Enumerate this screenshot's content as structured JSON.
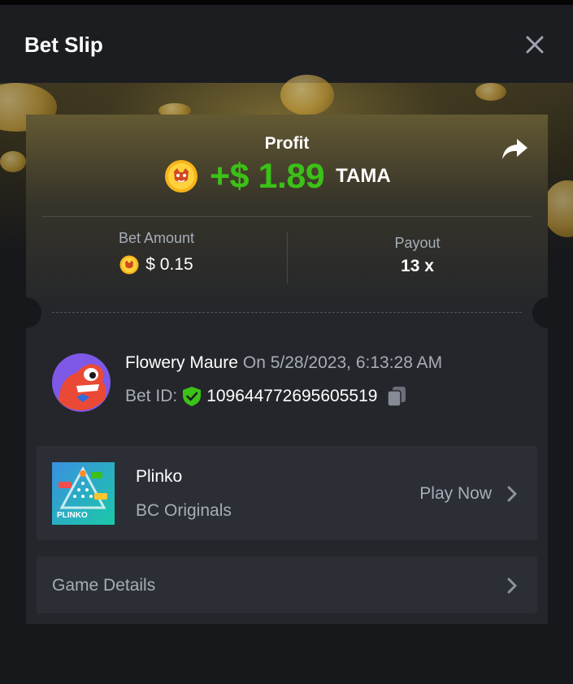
{
  "header": {
    "title": "Bet Slip"
  },
  "profit": {
    "label": "Profit",
    "value": "+$ 1.89",
    "currency": "TAMA"
  },
  "stats": {
    "bet_amount_label": "Bet Amount",
    "bet_amount_value": "$ 0.15",
    "payout_label": "Payout",
    "payout_value": "13 x"
  },
  "user": {
    "name": "Flowery Maure",
    "date": "On 5/28/2023, 6:13:28 AM",
    "bet_id_label": "Bet ID:",
    "bet_id": "109644772695605519"
  },
  "game": {
    "name": "Plinko",
    "provider": "BC Originals",
    "play_label": "Play Now",
    "thumb_text": "PLINKO"
  },
  "details": {
    "label": "Game Details"
  },
  "colors": {
    "profit_green": "#3bc117",
    "background": "#17181b",
    "card": "#24262b",
    "muted_text": "#a7adb8"
  },
  "icons": {
    "close": "close-icon",
    "share": "share-icon",
    "coin": "tama-coin-icon",
    "shield": "shield-check-icon",
    "copy": "copy-icon",
    "chevron": "chevron-right-icon"
  }
}
